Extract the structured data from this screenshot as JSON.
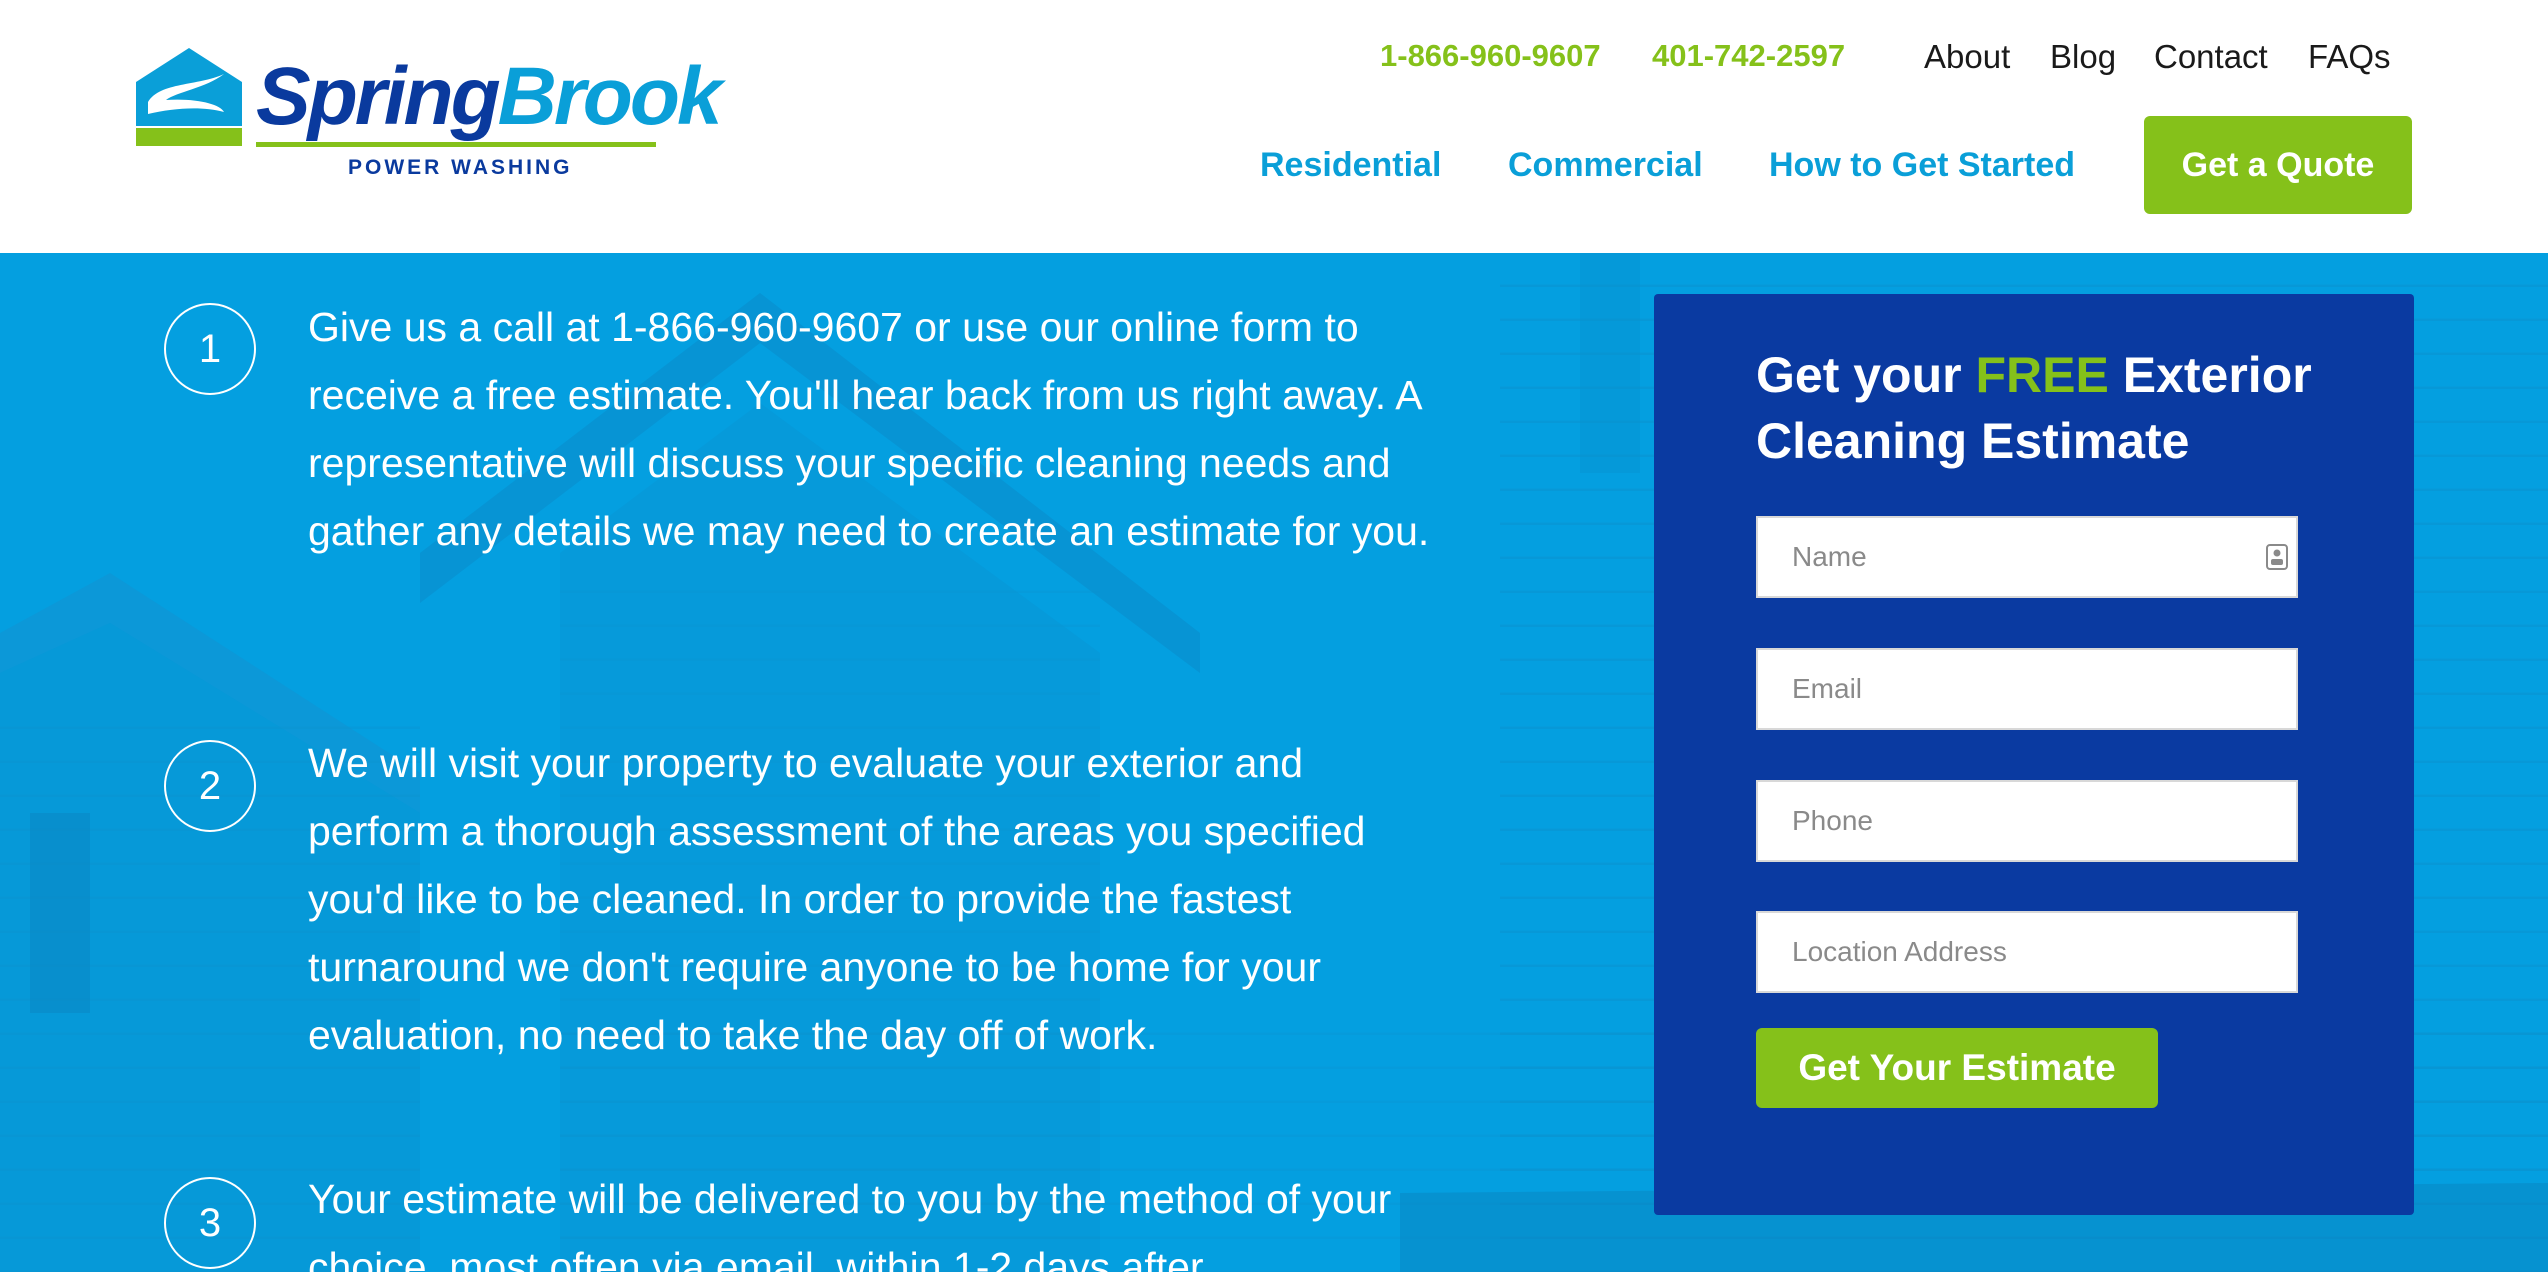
{
  "header": {
    "logo": {
      "word_part1": "Spring",
      "word_part2": "Brook",
      "subtitle": "POWER WASHING",
      "icon": "springbrook-house-logo-icon"
    },
    "phones": [
      "1-866-960-9607",
      "401-742-2597"
    ],
    "util_nav": [
      "About",
      "Blog",
      "Contact",
      "FAQs"
    ],
    "main_nav": [
      "Residential",
      "Commercial",
      "How to Get Started"
    ],
    "cta_label": "Get a Quote"
  },
  "steps": [
    {
      "number": "1",
      "text": "Give us a call at 1-866-960-9607 or use our online form to receive a free estimate. You'll hear back from us right away. A representative will discuss your specific cleaning needs and gather any details we may need to create an estimate for you."
    },
    {
      "number": "2",
      "text": "We will visit your property to evaluate your exterior and perform a thorough assessment of the areas you specified you'd like to be cleaned. In order to provide the fastest turnaround we don't require anyone to be home for your evaluation, no need to take the day off of work."
    },
    {
      "number": "3",
      "text": "Your estimate will be delivered to you by the method of your choice, most often via email, within 1-2 days after"
    }
  ],
  "form": {
    "title_before": "Get your ",
    "title_highlight": "FREE",
    "title_after": " Exterior Cleaning Estimate",
    "fields": {
      "name": {
        "placeholder": "Name",
        "value": ""
      },
      "email": {
        "placeholder": "Email",
        "value": ""
      },
      "phone": {
        "placeholder": "Phone",
        "value": ""
      },
      "address": {
        "placeholder": "Location Address",
        "value": ""
      }
    },
    "name_field_icon": "contact-card-icon",
    "submit_label": "Get Your Estimate"
  },
  "colors": {
    "brand_green": "#85c11a",
    "brand_light_blue": "#0a9fd8",
    "brand_dark_blue": "#0a3aa1",
    "hero_blue": "#049fe0"
  }
}
